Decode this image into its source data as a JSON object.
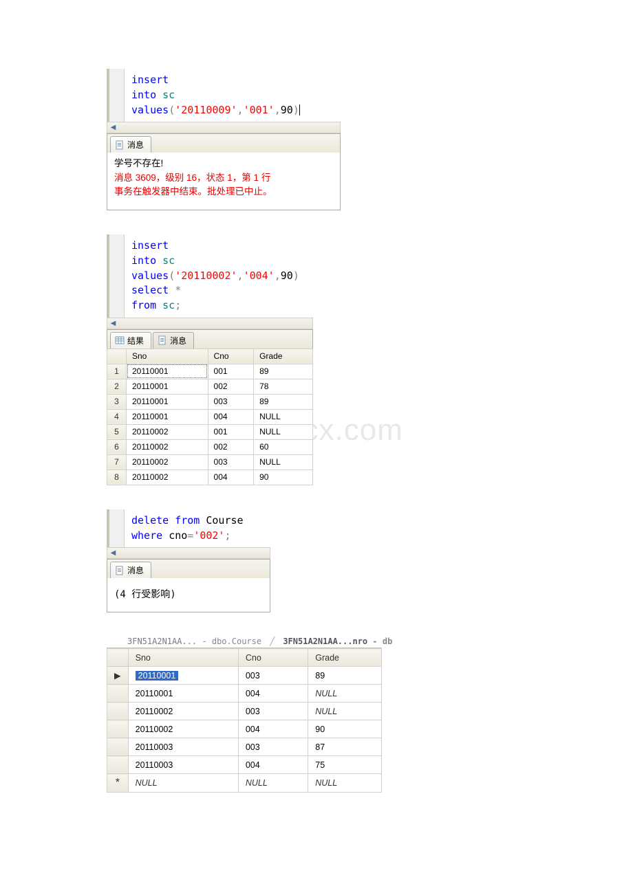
{
  "watermark": "www.bdocx.com",
  "panel1": {
    "sql": {
      "l1": "insert",
      "l2a": "into",
      "l2b": "sc",
      "l3a": "values",
      "l3b": "(",
      "l3c": "'20110009'",
      "l3d": ",",
      "l3e": "'001'",
      "l3f": ",",
      "l3g": "90",
      "l3h": ")"
    },
    "tab_msg": "消息",
    "msg_line1": "学号不存在!",
    "msg_line2": "消息 3609，级别 16，状态 1，第 1 行",
    "msg_line3": "事务在触发器中结束。批处理已中止。"
  },
  "panel2": {
    "sql": {
      "l1": "insert",
      "l2a": "into",
      "l2b": "sc",
      "l3a": "values",
      "l3b": "(",
      "l3c": "'20110002'",
      "l3d": ",",
      "l3e": "'004'",
      "l3f": ",",
      "l3g": "90",
      "l3h": ")",
      "l4a": "select",
      "l4b": "*",
      "l5a": "from",
      "l5b": "sc",
      "l5c": ";"
    },
    "tab_results": "结果",
    "tab_msg": "消息",
    "cols": {
      "c1": "Sno",
      "c2": "Cno",
      "c3": "Grade"
    },
    "rows": [
      {
        "n": "1",
        "sno": "20110001",
        "cno": "001",
        "grade": "89"
      },
      {
        "n": "2",
        "sno": "20110001",
        "cno": "002",
        "grade": "78"
      },
      {
        "n": "3",
        "sno": "20110001",
        "cno": "003",
        "grade": "89"
      },
      {
        "n": "4",
        "sno": "20110001",
        "cno": "004",
        "grade": "NULL"
      },
      {
        "n": "5",
        "sno": "20110002",
        "cno": "001",
        "grade": "NULL"
      },
      {
        "n": "6",
        "sno": "20110002",
        "cno": "002",
        "grade": "60"
      },
      {
        "n": "7",
        "sno": "20110002",
        "cno": "003",
        "grade": "NULL"
      },
      {
        "n": "8",
        "sno": "20110002",
        "cno": "004",
        "grade": "90"
      }
    ]
  },
  "panel3": {
    "sql": {
      "l1a": "delete",
      "l1b": "from",
      "l1c": "Course",
      "l2a": "where",
      "l2b": "cno",
      "l2c": "=",
      "l2d": "'002'",
      "l2e": ";"
    },
    "tab_msg": "消息",
    "msg": "(4 行受影响)"
  },
  "panel4": {
    "tabs": {
      "t1a": "3FN51A2N1AA...",
      "t1b": "- dbo.Course",
      "t2a": "3FN51A2N1AA...nro",
      "t2b": "- db"
    },
    "cols": {
      "c1": "Sno",
      "c2": "Cno",
      "c3": "Grade"
    },
    "rows": [
      {
        "sel": true,
        "sno": "20110001",
        "cno": "003",
        "grade": "89"
      },
      {
        "sel": false,
        "sno": "20110001",
        "cno": "004",
        "grade": "NULL"
      },
      {
        "sel": false,
        "sno": "20110002",
        "cno": "003",
        "grade": "NULL"
      },
      {
        "sel": false,
        "sno": "20110002",
        "cno": "004",
        "grade": "90"
      },
      {
        "sel": false,
        "sno": "20110003",
        "cno": "003",
        "grade": "87"
      },
      {
        "sel": false,
        "sno": "20110003",
        "cno": "004",
        "grade": "75"
      }
    ],
    "newrow": {
      "sno": "NULL",
      "cno": "NULL",
      "grade": "NULL"
    },
    "marker_current": "▶",
    "marker_new": "*"
  }
}
